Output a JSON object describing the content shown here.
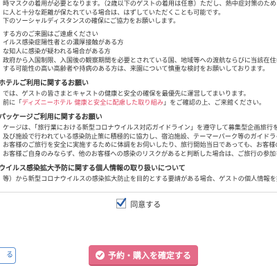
{
  "terms": {
    "intro_lines": [
      "時マスクの着用が必要となります。（2歳以下のゲストの着用は任意）ただし、熱中症対策のため、夏期の",
      "に人と十分な距離が保たれている場合は、はずしていただくことも可能です。",
      "下のソーシャルディスタンスの確保にご協力をお願いします。"
    ],
    "refrain_lines": [
      "する方のご来園はご遠慮ください",
      "イルス感染症陽性者との濃厚接触がある方",
      "な知人に感染が疑われる場合がある方",
      "政府から入国制限、入国後の観察期間を必要とされている国、地域等への渡航ならびに当該在住者との濃厚",
      "する可能性の高い高齢者や持病のある方は、来園について慎重な検討をお願いしております。"
    ],
    "hotel_heading": "ホテルご利用に関するお願い",
    "hotel_lines": [
      "では、ゲストの皆さまとキャストの健康と安全の確保を最優先に運営してまいります。",
      "前に「",
      "ディズニーホテル 健康と安全に配慮した取り組み",
      "」をご確認の上、ご来館ください。"
    ],
    "package_heading": "パッケージご利用に関するお願い",
    "package_lines": [
      "ケージは、「旅行業における新型コロナウイルス対応ガイドライン」を遵守して募集型企画旅行を企画・実",
      "及び施設で行われている感染防止策に積極的に協力し、宿泊施設、テーマーパーク等のガイドラインを遵守頂",
      "お客様のご旅行を安全に実施するために体調をお伺いしたり、旅行開始当日であっても、お客様の体調によ",
      "お客様ご自身のみならず、他のお客様への感染のリスクがあると判断した場合は、ご旅行の参加をご遠慮いただく"
    ],
    "privacy_heading": "ウイルス感染拡大予防に関する個人情報の取り扱いについて",
    "privacy_lines": [
      "等）から新型コロナウイルスの感染拡大防止を目的とする要請がある場合、ゲストの個人情報を提供する事が"
    ]
  },
  "agree": {
    "label": "同意する",
    "checked": true
  },
  "buttons": {
    "back_label": "る",
    "confirm_label": "予約・購入を確定する"
  },
  "colors": {
    "confirm_bg": "#e46b88",
    "link": "#e0405e",
    "back_border": "#5b8fd0"
  },
  "icons": {
    "agree": "checkmark-icon",
    "confirm": "check-circle-icon"
  }
}
